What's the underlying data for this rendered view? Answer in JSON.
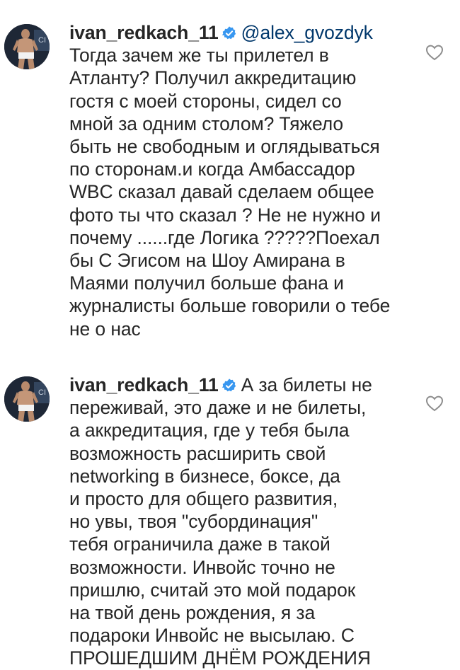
{
  "comments": [
    {
      "username": "ivan_redkach_11",
      "mention": "@alex_gvozdyk",
      "text": "Тогда зачем же ты прилетел в\nАтланту? Получил аккредитацию\nгостя с моей стороны, сидел со\nмной за одним столом? Тяжело\nбыть не свободным и оглядываться\nпо сторонам.и когда Амбассадор\nWBC сказал давай сделаем общее\nфото ты что сказал ? Не не нужно и\nпочему ......где Логика ?????Поехал\nбы С Эгисом на Шоу Амирана в\nМаями получил больше фана и\nжурналисты больше говорили о тебе\nне о нас",
      "icons": {
        "avatar": "user-avatar",
        "badge": "verified-badge-icon",
        "like": "heart-icon"
      }
    },
    {
      "username": "ivan_redkach_11",
      "text_first": "А за билеты не",
      "text": "переживай,  это даже и не билеты,\nа аккредитация, где у тебя была\nвозможность расширить свой\nnetworking в бизнесе,  боксе, да\nи просто для общего развития,\nно увы,  твоя \"субординация\"\nтебя ограничила даже в такой\nвозможности. Инвойс точно не\nпришлю, считай это мой подарок\nна твой день рождения, я за\nподароки Инвойс не высылаю. С\nПРОШЕДШИМ ДНЁМ РОЖДЕНИЯ",
      "icons": {
        "avatar": "user-avatar",
        "badge": "verified-badge-icon",
        "like": "heart-icon"
      }
    }
  ],
  "colors": {
    "text": "#262626",
    "mention": "#00376b",
    "verified": "#3897f0",
    "heart_outline": "#8e8e8e"
  }
}
